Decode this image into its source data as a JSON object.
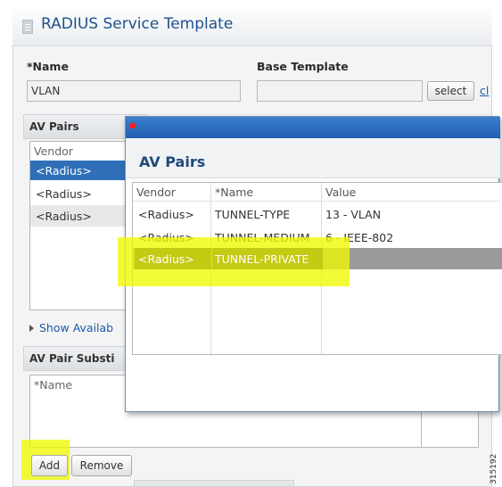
{
  "page": {
    "title": "RADIUS Service Template",
    "name_label": "*Name",
    "name_value": "VLAN",
    "base_template_label": "Base Template",
    "base_template_value": "",
    "select_button": "select",
    "clear_link": "cl",
    "av_pairs_section": "AV Pairs",
    "vendor_header": "Vendor",
    "vendor_rows": [
      "<Radius>",
      "<Radius>",
      "<Radius>"
    ],
    "show_available": "Show Availab",
    "substitution_section": "AV Pair Substi",
    "sub_name_header": "*Name",
    "add_button": "Add",
    "remove_button": "Remove"
  },
  "dialog": {
    "title": "AV Pairs",
    "columns": [
      "Vendor",
      "*Name",
      "Value"
    ],
    "rows": [
      {
        "vendor": "<Radius>",
        "name": "TUNNEL-TYPE",
        "value": "13 - VLAN"
      },
      {
        "vendor": "<Radius>",
        "name": "TUNNEL-MEDIUM",
        "value": "6 - IEEE-802"
      },
      {
        "vendor": "<Radius>",
        "name": "TUNNEL-PRIVATE",
        "value": ""
      }
    ],
    "selected_row": 2
  },
  "figure_id": "315192",
  "colors": {
    "title_blue": "#20528e",
    "highlight": "#f0fa00",
    "dialog_bar": "#1f5fb0"
  }
}
